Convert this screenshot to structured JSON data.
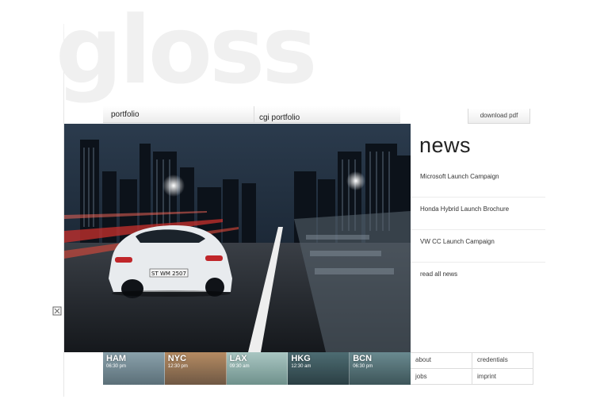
{
  "brand": {
    "logo_text": "gloss"
  },
  "nav": {
    "portfolio": "portfolio",
    "cgi_portfolio": "cgi portfolio"
  },
  "download_label": "download pdf",
  "hero": {
    "plate": "ST WM 2507"
  },
  "news": {
    "title": "news",
    "items": [
      "Microsoft Launch Campaign",
      "Honda Hybrid Launch Brochure",
      "VW CC Launch Campaign"
    ],
    "read_all": "read all news"
  },
  "cities": [
    {
      "name": "HAM",
      "time": "06:30 pm",
      "color": "#6f8a96"
    },
    {
      "name": "NYC",
      "time": "12:30 pm",
      "color": "#9b7a5a"
    },
    {
      "name": "LAX",
      "time": "09:30 am",
      "color": "#7fa3a0"
    },
    {
      "name": "HKG",
      "time": "12:30 am",
      "color": "#3d5a5f"
    },
    {
      "name": "BCN",
      "time": "06:30 pm",
      "color": "#4f6e73"
    }
  ],
  "footer": {
    "about": "about",
    "credentials": "credentials",
    "jobs": "jobs",
    "imprint": "imprint"
  },
  "colors": {
    "text": "#333333",
    "logo_watermark": "#f0f0f0",
    "hero_sky": "#1c2a3a"
  },
  "icons": {
    "expand": "expand-icon"
  }
}
